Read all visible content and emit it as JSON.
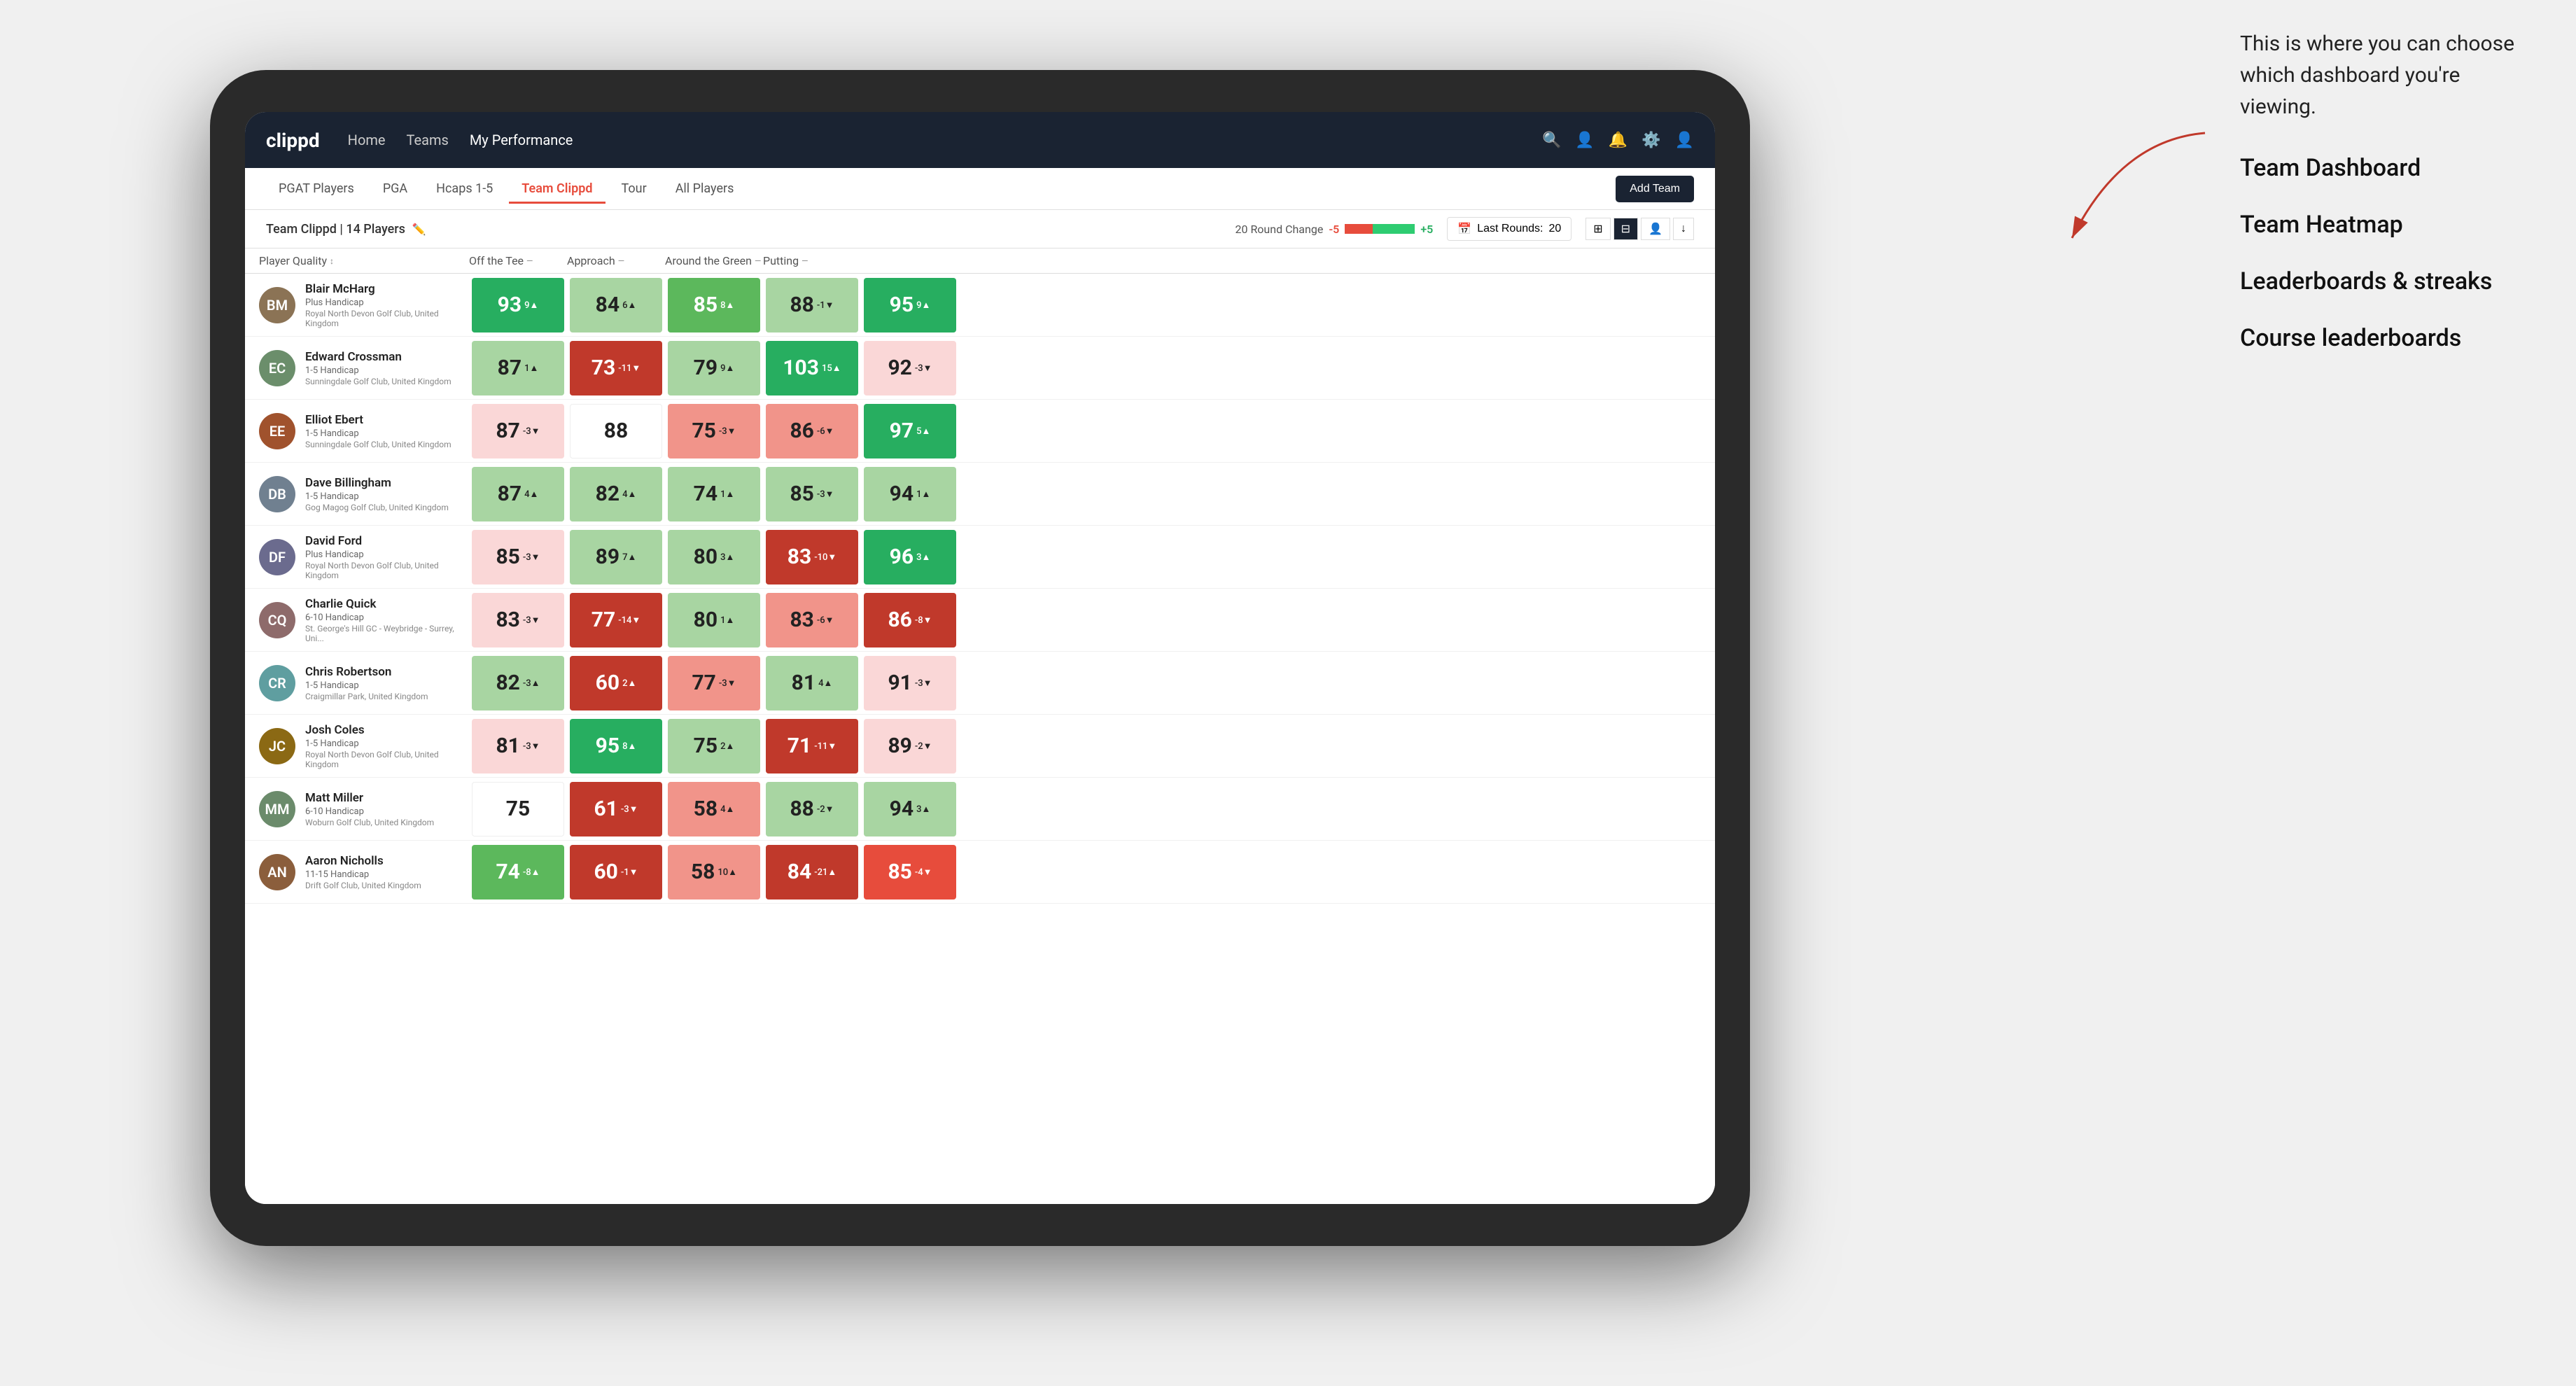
{
  "annotation": {
    "intro": "This is where you can choose which dashboard you're viewing.",
    "options": [
      "Team Dashboard",
      "Team Heatmap",
      "Leaderboards & streaks",
      "Course leaderboards"
    ]
  },
  "navbar": {
    "logo": "clippd",
    "links": [
      "Home",
      "Teams",
      "My Performance"
    ],
    "active_link": "My Performance"
  },
  "subnav": {
    "tabs": [
      "PGAT Players",
      "PGA",
      "Hcaps 1-5",
      "Team Clippd",
      "Tour",
      "All Players"
    ],
    "active_tab": "Team Clippd",
    "add_team_label": "Add Team"
  },
  "team_bar": {
    "team_name": "Team Clippd",
    "player_count": "14 Players",
    "round_change_label": "20 Round Change",
    "change_minus": "-5",
    "change_plus": "+5",
    "last_rounds_label": "Last Rounds:",
    "last_rounds_value": "20"
  },
  "col_headers": {
    "player": "Player Quality",
    "off_tee": "Off the Tee",
    "approach": "Approach",
    "around_green": "Around the Green",
    "putting": "Putting"
  },
  "players": [
    {
      "name": "Blair McHarg",
      "hcp": "Plus Handicap",
      "club": "Royal North Devon Golf Club, United Kingdom",
      "avatar_initials": "BM",
      "avatar_class": "av-1",
      "scores": [
        {
          "value": "93",
          "change": "9▲",
          "color": "green-dark"
        },
        {
          "value": "84",
          "change": "6▲",
          "color": "green-light"
        },
        {
          "value": "85",
          "change": "8▲",
          "color": "green-mid"
        },
        {
          "value": "88",
          "change": "-1▼",
          "color": "green-light"
        },
        {
          "value": "95",
          "change": "9▲",
          "color": "green-dark"
        }
      ]
    },
    {
      "name": "Edward Crossman",
      "hcp": "1-5 Handicap",
      "club": "Sunningdale Golf Club, United Kingdom",
      "avatar_initials": "EC",
      "avatar_class": "av-2",
      "scores": [
        {
          "value": "87",
          "change": "1▲",
          "color": "green-light"
        },
        {
          "value": "73",
          "change": "-11▼",
          "color": "red-dark"
        },
        {
          "value": "79",
          "change": "9▲",
          "color": "green-light"
        },
        {
          "value": "103",
          "change": "15▲",
          "color": "green-dark"
        },
        {
          "value": "92",
          "change": "-3▼",
          "color": "pink-light"
        }
      ]
    },
    {
      "name": "Elliot Ebert",
      "hcp": "1-5 Handicap",
      "club": "Sunningdale Golf Club, United Kingdom",
      "avatar_initials": "EE",
      "avatar_class": "av-3",
      "scores": [
        {
          "value": "87",
          "change": "-3▼",
          "color": "pink-light"
        },
        {
          "value": "88",
          "change": "",
          "color": "white"
        },
        {
          "value": "75",
          "change": "-3▼",
          "color": "red-light"
        },
        {
          "value": "86",
          "change": "-6▼",
          "color": "red-light"
        },
        {
          "value": "97",
          "change": "5▲",
          "color": "green-dark"
        }
      ]
    },
    {
      "name": "Dave Billingham",
      "hcp": "1-5 Handicap",
      "club": "Gog Magog Golf Club, United Kingdom",
      "avatar_initials": "DB",
      "avatar_class": "av-4",
      "scores": [
        {
          "value": "87",
          "change": "4▲",
          "color": "green-light"
        },
        {
          "value": "82",
          "change": "4▲",
          "color": "green-light"
        },
        {
          "value": "74",
          "change": "1▲",
          "color": "green-light"
        },
        {
          "value": "85",
          "change": "-3▼",
          "color": "green-light"
        },
        {
          "value": "94",
          "change": "1▲",
          "color": "green-light"
        }
      ]
    },
    {
      "name": "David Ford",
      "hcp": "Plus Handicap",
      "club": "Royal North Devon Golf Club, United Kingdom",
      "avatar_initials": "DF",
      "avatar_class": "av-5",
      "scores": [
        {
          "value": "85",
          "change": "-3▼",
          "color": "pink-light"
        },
        {
          "value": "89",
          "change": "7▲",
          "color": "green-light"
        },
        {
          "value": "80",
          "change": "3▲",
          "color": "green-light"
        },
        {
          "value": "83",
          "change": "-10▼",
          "color": "red-dark"
        },
        {
          "value": "96",
          "change": "3▲",
          "color": "green-dark"
        }
      ]
    },
    {
      "name": "Charlie Quick",
      "hcp": "6-10 Handicap",
      "club": "St. George's Hill GC - Weybridge - Surrey, Uni...",
      "avatar_initials": "CQ",
      "avatar_class": "av-6",
      "scores": [
        {
          "value": "83",
          "change": "-3▼",
          "color": "pink-light"
        },
        {
          "value": "77",
          "change": "-14▼",
          "color": "red-dark"
        },
        {
          "value": "80",
          "change": "1▲",
          "color": "green-light"
        },
        {
          "value": "83",
          "change": "-6▼",
          "color": "red-light"
        },
        {
          "value": "86",
          "change": "-8▼",
          "color": "red-dark"
        }
      ]
    },
    {
      "name": "Chris Robertson",
      "hcp": "1-5 Handicap",
      "club": "Craigmillar Park, United Kingdom",
      "avatar_initials": "CR",
      "avatar_class": "av-7",
      "scores": [
        {
          "value": "82",
          "change": "-3▲",
          "color": "green-light"
        },
        {
          "value": "60",
          "change": "2▲",
          "color": "red-dark"
        },
        {
          "value": "77",
          "change": "-3▼",
          "color": "red-light"
        },
        {
          "value": "81",
          "change": "4▲",
          "color": "green-light"
        },
        {
          "value": "91",
          "change": "-3▼",
          "color": "pink-light"
        }
      ]
    },
    {
      "name": "Josh Coles",
      "hcp": "1-5 Handicap",
      "club": "Royal North Devon Golf Club, United Kingdom",
      "avatar_initials": "JC",
      "avatar_class": "av-8",
      "scores": [
        {
          "value": "81",
          "change": "-3▼",
          "color": "pink-light"
        },
        {
          "value": "95",
          "change": "8▲",
          "color": "green-dark"
        },
        {
          "value": "75",
          "change": "2▲",
          "color": "green-light"
        },
        {
          "value": "71",
          "change": "-11▼",
          "color": "red-dark"
        },
        {
          "value": "89",
          "change": "-2▼",
          "color": "pink-light"
        }
      ]
    },
    {
      "name": "Matt Miller",
      "hcp": "6-10 Handicap",
      "club": "Woburn Golf Club, United Kingdom",
      "avatar_initials": "MM",
      "avatar_class": "av-9",
      "scores": [
        {
          "value": "75",
          "change": "",
          "color": "white"
        },
        {
          "value": "61",
          "change": "-3▼",
          "color": "red-dark"
        },
        {
          "value": "58",
          "change": "4▲",
          "color": "red-light"
        },
        {
          "value": "88",
          "change": "-2▼",
          "color": "green-light"
        },
        {
          "value": "94",
          "change": "3▲",
          "color": "green-light"
        }
      ]
    },
    {
      "name": "Aaron Nicholls",
      "hcp": "11-15 Handicap",
      "club": "Drift Golf Club, United Kingdom",
      "avatar_initials": "AN",
      "avatar_class": "av-10",
      "scores": [
        {
          "value": "74",
          "change": "-8▲",
          "color": "green-mid"
        },
        {
          "value": "60",
          "change": "-1▼",
          "color": "red-dark"
        },
        {
          "value": "58",
          "change": "10▲",
          "color": "red-light"
        },
        {
          "value": "84",
          "change": "-21▲",
          "color": "red-dark"
        },
        {
          "value": "85",
          "change": "-4▼",
          "color": "red-mid"
        }
      ]
    }
  ]
}
